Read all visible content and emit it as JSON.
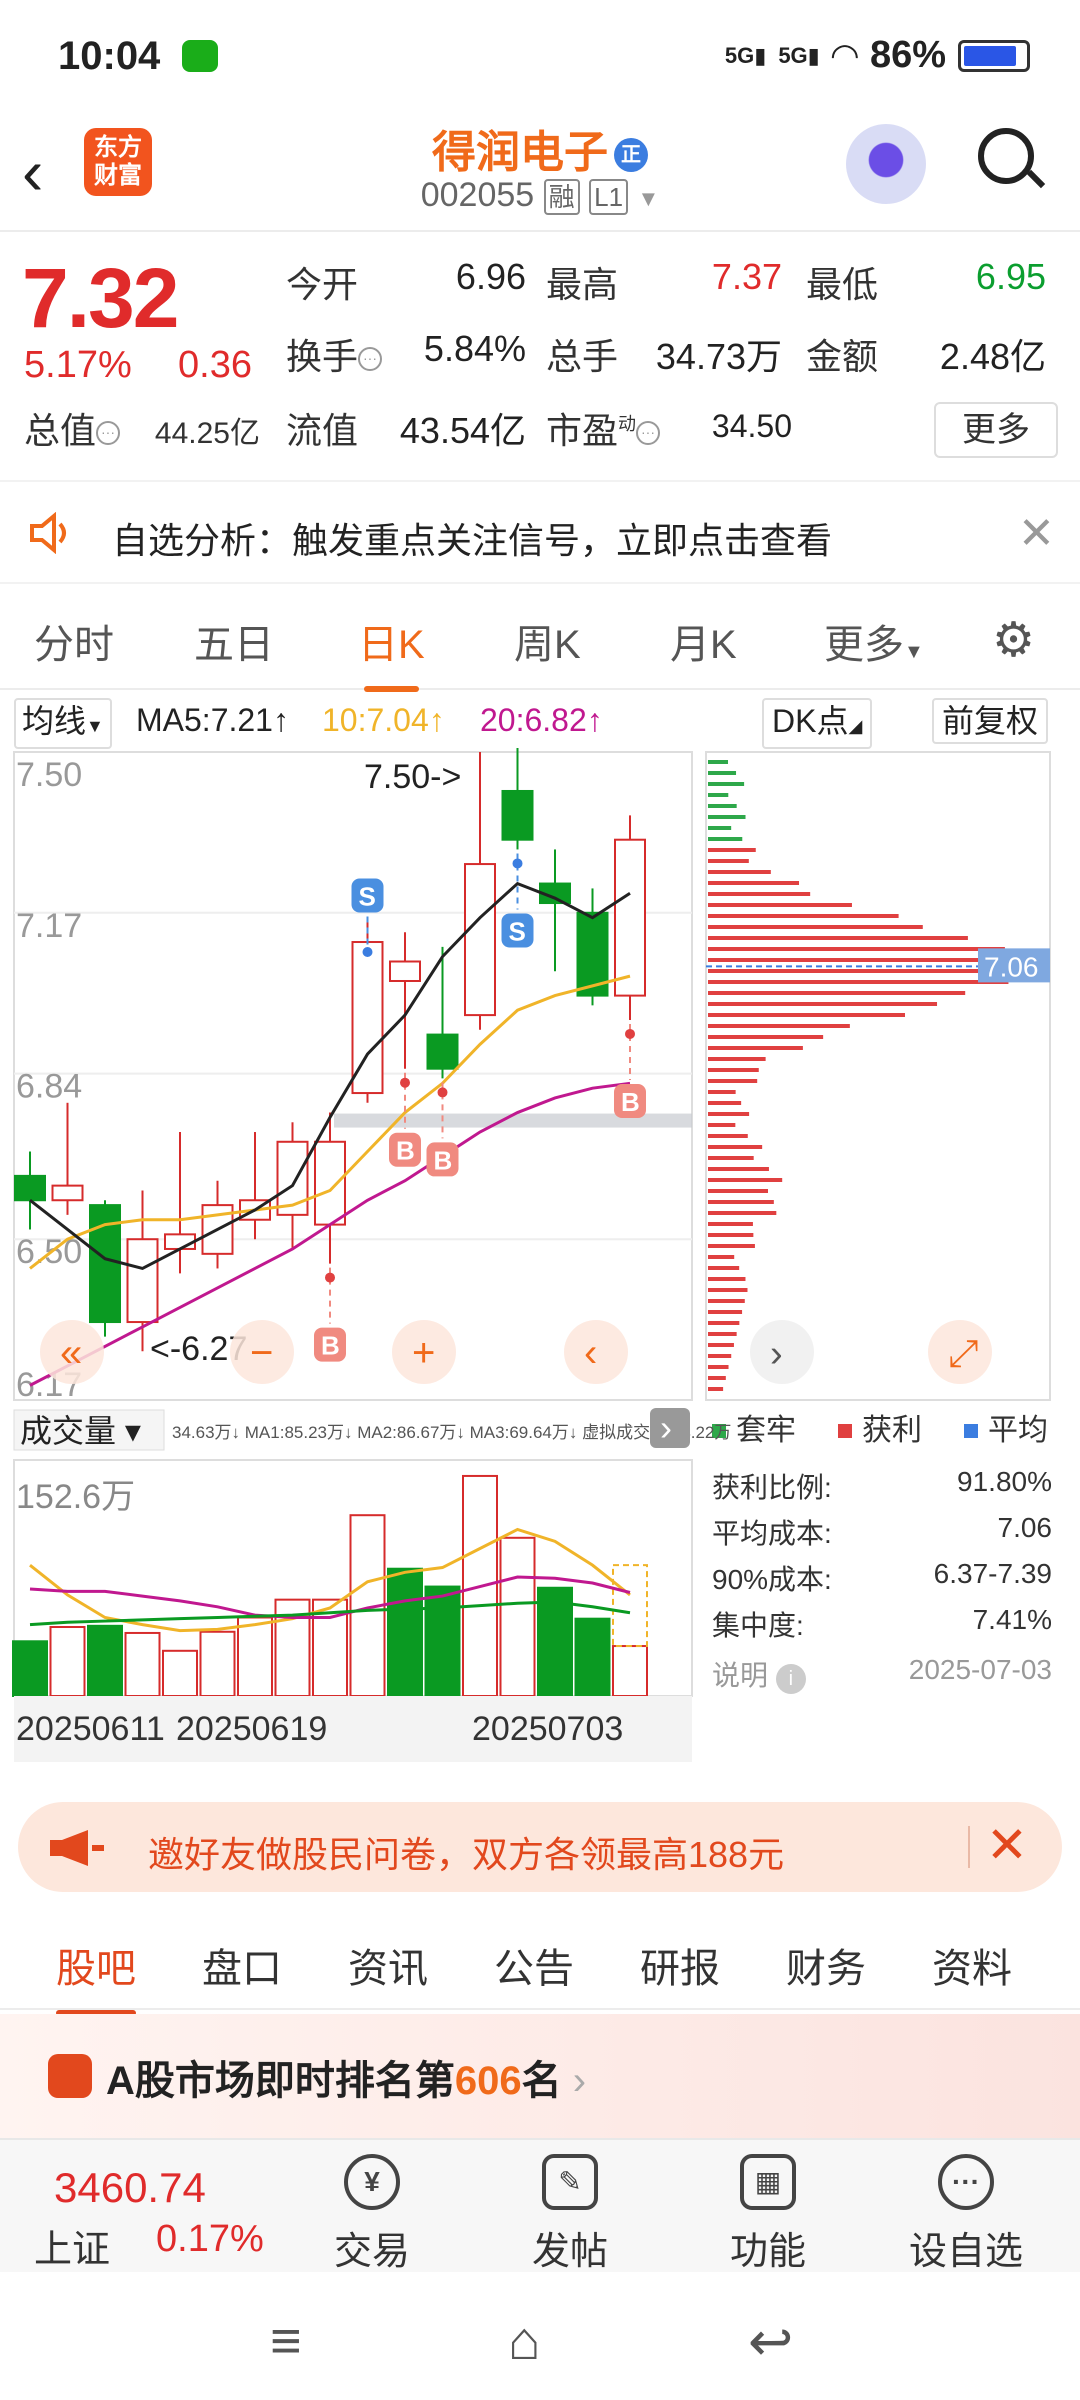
{
  "status_bar": {
    "time": "10:04",
    "net1": "5G",
    "net2": "5G",
    "battery": "86%",
    "battery_level": 0.86
  },
  "header": {
    "logo_line1": "东方",
    "logo_line2": "财富",
    "stock_name": "得润电子",
    "name_badge": "正",
    "stock_code": "002055",
    "tag1": "融",
    "tag2": "L1"
  },
  "quote": {
    "price": "7.32",
    "change_pct": "5.17%",
    "change_amt": "0.36",
    "open_label": "今开",
    "open": "6.96",
    "high_label": "最高",
    "high": "7.37",
    "low_label": "最低",
    "low": "6.95",
    "turnover_label": "换手",
    "turnover": "5.84%",
    "volume_label": "总手",
    "volume": "34.73万",
    "amount_label": "金额",
    "amount": "2.48亿",
    "mktcap_label": "总值",
    "mktcap": "44.25亿",
    "float_label": "流值",
    "float": "43.54亿",
    "pe_label": "市盈",
    "pe_sup": "动",
    "pe": "34.50",
    "more": "更多"
  },
  "notice": {
    "text": "自选分析：触发重点关注信号，立即点击查看"
  },
  "kline_tabs": [
    "分时",
    "五日",
    "日K",
    "周K",
    "月K",
    "更多"
  ],
  "ma_row": {
    "indicator": "均线",
    "ma5": "MA5:7.21",
    "ma10": "10:7.04",
    "ma20": "20:6.82",
    "dk": "DK点",
    "fq": "前复权",
    "ma5_color": "#222222",
    "ma10_color": "#f0b429",
    "ma20_color": "#c0188f"
  },
  "chart_data": {
    "type": "candlestick",
    "y_ticks": [
      "7.50",
      "7.17",
      "6.84",
      "6.50",
      "6.17"
    ],
    "ylim": [
      6.17,
      7.5
    ],
    "max_annotation": "7.50->",
    "min_annotation": "<-6.27",
    "dates": [
      "20250611",
      "20250619",
      "20250703"
    ],
    "candles": [
      {
        "o": 6.58,
        "c": 6.63,
        "h": 6.68,
        "l": 6.52,
        "up": false
      },
      {
        "o": 6.58,
        "c": 6.61,
        "h": 6.78,
        "l": 6.55,
        "up": true
      },
      {
        "o": 6.57,
        "c": 6.33,
        "h": 6.58,
        "l": 6.3,
        "up": false
      },
      {
        "o": 6.33,
        "c": 6.5,
        "h": 6.6,
        "l": 6.27,
        "up": true
      },
      {
        "o": 6.48,
        "c": 6.51,
        "h": 6.72,
        "l": 6.43,
        "up": true
      },
      {
        "o": 6.47,
        "c": 6.57,
        "h": 6.62,
        "l": 6.44,
        "up": true
      },
      {
        "o": 6.54,
        "c": 6.58,
        "h": 6.72,
        "l": 6.5,
        "up": true
      },
      {
        "o": 6.55,
        "c": 6.7,
        "h": 6.74,
        "l": 6.48,
        "up": true
      },
      {
        "o": 6.53,
        "c": 6.7,
        "h": 6.76,
        "l": 6.45,
        "up": true
      },
      {
        "o": 6.8,
        "c": 7.11,
        "h": 7.15,
        "l": 6.78,
        "up": true
      },
      {
        "o": 7.03,
        "c": 7.07,
        "h": 7.13,
        "l": 6.85,
        "up": true
      },
      {
        "o": 6.92,
        "c": 6.85,
        "h": 7.1,
        "l": 6.83,
        "up": false
      },
      {
        "o": 6.96,
        "c": 7.27,
        "h": 7.5,
        "l": 6.93,
        "up": true
      },
      {
        "o": 7.42,
        "c": 7.32,
        "h": 7.52,
        "l": 7.3,
        "up": false
      },
      {
        "o": 7.23,
        "c": 7.19,
        "h": 7.3,
        "l": 7.05,
        "up": false
      },
      {
        "o": 7.17,
        "c": 7.0,
        "h": 7.22,
        "l": 6.98,
        "up": false
      },
      {
        "o": 7.0,
        "c": 7.32,
        "h": 7.37,
        "l": 6.95,
        "up": true
      }
    ],
    "ma5": [
      6.58,
      6.52,
      6.46,
      6.44,
      6.48,
      6.52,
      6.56,
      6.61,
      6.75,
      6.88,
      6.96,
      7.08,
      7.16,
      7.23,
      7.2,
      7.16,
      7.21
    ],
    "ma10": [
      6.44,
      6.5,
      6.53,
      6.54,
      6.54,
      6.55,
      6.56,
      6.57,
      6.6,
      6.68,
      6.76,
      6.82,
      6.9,
      6.97,
      7.0,
      7.02,
      7.04
    ],
    "ma20": [
      6.2,
      6.24,
      6.28,
      6.32,
      6.36,
      6.4,
      6.44,
      6.48,
      6.53,
      6.58,
      6.62,
      6.67,
      6.72,
      6.76,
      6.79,
      6.81,
      6.82
    ],
    "signals": [
      {
        "idx": 9,
        "type": "S",
        "pos": "above"
      },
      {
        "idx": 13,
        "type": "S",
        "pos": "below"
      },
      {
        "idx": 8,
        "type": "B",
        "pos": "below"
      },
      {
        "idx": 10,
        "type": "B",
        "pos": "below"
      },
      {
        "idx": 11,
        "type": "B",
        "pos": "below"
      },
      {
        "idx": 16,
        "type": "B",
        "pos": "below"
      }
    ],
    "chip_avg_cost": "7.06",
    "volume_label": "成交量",
    "volume_summary": "34.63万↓ MA1:85.23万↓ MA2:86.67万↓ MA3:69.64万↓ 虚拟成交量:74.22万",
    "volume_max": "152.6万",
    "volumes": [
      46,
      58,
      59,
      53,
      38,
      54,
      66,
      81,
      81,
      152,
      107,
      92,
      185,
      133,
      91,
      65,
      42
    ],
    "vol_up": [
      false,
      true,
      false,
      true,
      true,
      true,
      true,
      true,
      true,
      true,
      false,
      false,
      true,
      true,
      false,
      false,
      true
    ],
    "vol_ma1": [
      110,
      85,
      66,
      60,
      55,
      56,
      60,
      65,
      74,
      96,
      104,
      108,
      124,
      140,
      130,
      110,
      85
    ],
    "vol_ma2": [
      90,
      88,
      88,
      84,
      80,
      75,
      68,
      66,
      66,
      74,
      80,
      84,
      92,
      100,
      99,
      95,
      87
    ],
    "vol_ma3": [
      60,
      62,
      63,
      64,
      65,
      66,
      67,
      68,
      70,
      72,
      73,
      74,
      76,
      78,
      79,
      75,
      70
    ]
  },
  "chip": {
    "legend": [
      "套牢",
      "获利",
      "平均"
    ],
    "legend_colors": [
      "#2ea84a",
      "#e04040",
      "#3b7de0"
    ],
    "profit_ratio_label": "获利比例:",
    "profit_ratio": "91.80%",
    "avg_cost_label": "平均成本:",
    "avg_cost": "7.06",
    "cost90_label": "90%成本:",
    "cost90": "6.37-7.39",
    "concentration_label": "集中度:",
    "concentration": "7.41%",
    "note": "说明",
    "date": "2025-07-03"
  },
  "promo": {
    "text": "邀好友做股民问卷，双方各领最高188元"
  },
  "bottom_tabs": [
    "股吧",
    "盘口",
    "资讯",
    "公告",
    "研报",
    "财务",
    "资料"
  ],
  "rank": {
    "prefix": "A股市场即时排名第",
    "number": "606",
    "suffix": "名"
  },
  "bottom_nav": {
    "index_value": "3460.74",
    "index_name": "上证",
    "index_change": "0.17%",
    "items": [
      {
        "label": "交易",
        "icon": "¥"
      },
      {
        "label": "发帖",
        "icon": "✎"
      },
      {
        "label": "功能",
        "icon": "▦"
      },
      {
        "label": "设自选",
        "icon": "···"
      }
    ]
  }
}
